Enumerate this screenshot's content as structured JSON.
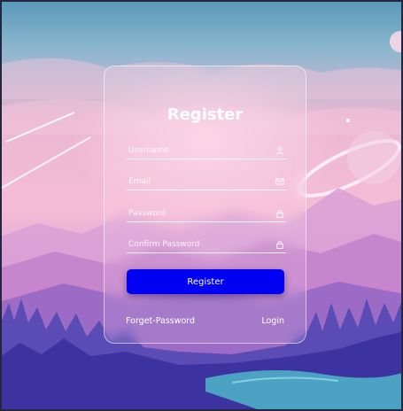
{
  "form": {
    "title": "Register",
    "fields": [
      {
        "placeholder": "Username",
        "icon": "user-icon"
      },
      {
        "placeholder": "Email",
        "icon": "mail-icon"
      },
      {
        "placeholder": "Password",
        "icon": "lock-icon"
      },
      {
        "placeholder": "Confirm Password",
        "icon": "lock-icon"
      }
    ],
    "submit_label": "Register",
    "forgot_link": "Forget-Password",
    "login_link": "Login"
  },
  "colors": {
    "button": "#0000f2",
    "text": "#ffffff",
    "sky_top": "#5f9fc0",
    "sky_pink": "#f3b7d2",
    "mountains": "#c98ad0",
    "forest": "#3f3aa0",
    "water": "#4fb6c9"
  }
}
